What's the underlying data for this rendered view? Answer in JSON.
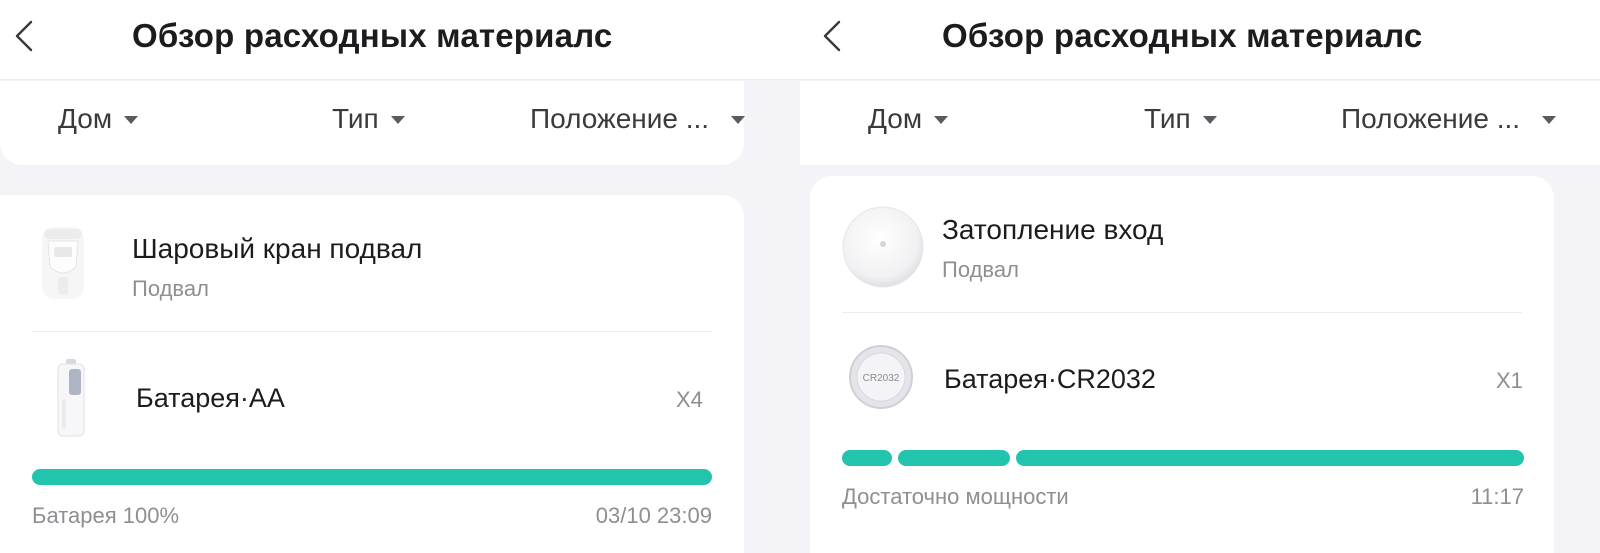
{
  "left": {
    "header": {
      "title": "Обзор расходных материалс"
    },
    "filters": [
      {
        "label": "Дом"
      },
      {
        "label": "Тип"
      },
      {
        "label": "Положение ..."
      }
    ],
    "device": {
      "name": "Шаровый кран подвал",
      "location": "Подвал",
      "image": "valve-device"
    },
    "battery": {
      "name": "Батарея·AA",
      "count": "X4",
      "image": "aa-battery",
      "level": 1.0
    },
    "status": "Батарея 100%",
    "timestamp": "03/10 23:09"
  },
  "right": {
    "header": {
      "title": "Обзор расходных материалс"
    },
    "filters": [
      {
        "label": "Дом"
      },
      {
        "label": "Тип"
      },
      {
        "label": "Положение ..."
      }
    ],
    "device": {
      "name": "Затопление вход",
      "location": "Подвал",
      "image": "flood-sensor"
    },
    "battery": {
      "name": "Батарея·CR2032",
      "count": "X1",
      "image": "coin-battery",
      "coin_label": "CR2032",
      "level_segments": 3,
      "level_segments_total": 3
    },
    "status": "Достаточно мощности",
    "timestamp": "11:17"
  },
  "colors": {
    "accent": "#22c4ae",
    "secondary_text": "#8e8e93",
    "background": "#f3f3f8"
  },
  "icons": {
    "back": "chevron-left-icon",
    "dropdown": "caret-down-icon"
  }
}
